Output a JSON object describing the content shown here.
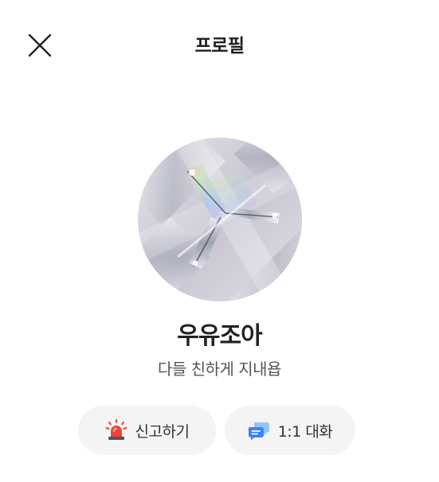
{
  "header": {
    "title": "프로필",
    "close_icon": "close-icon"
  },
  "profile": {
    "avatar": "crystal-abstract-image",
    "nickname": "우유조아",
    "status_message": "다들 친하게 지내욥"
  },
  "actions": [
    {
      "label": "신고하기",
      "icon": "siren-icon",
      "accent": "#f04438"
    },
    {
      "label": "1:1 대화",
      "icon": "chat-bubbles-icon",
      "accent": "#3b82f6"
    }
  ]
}
